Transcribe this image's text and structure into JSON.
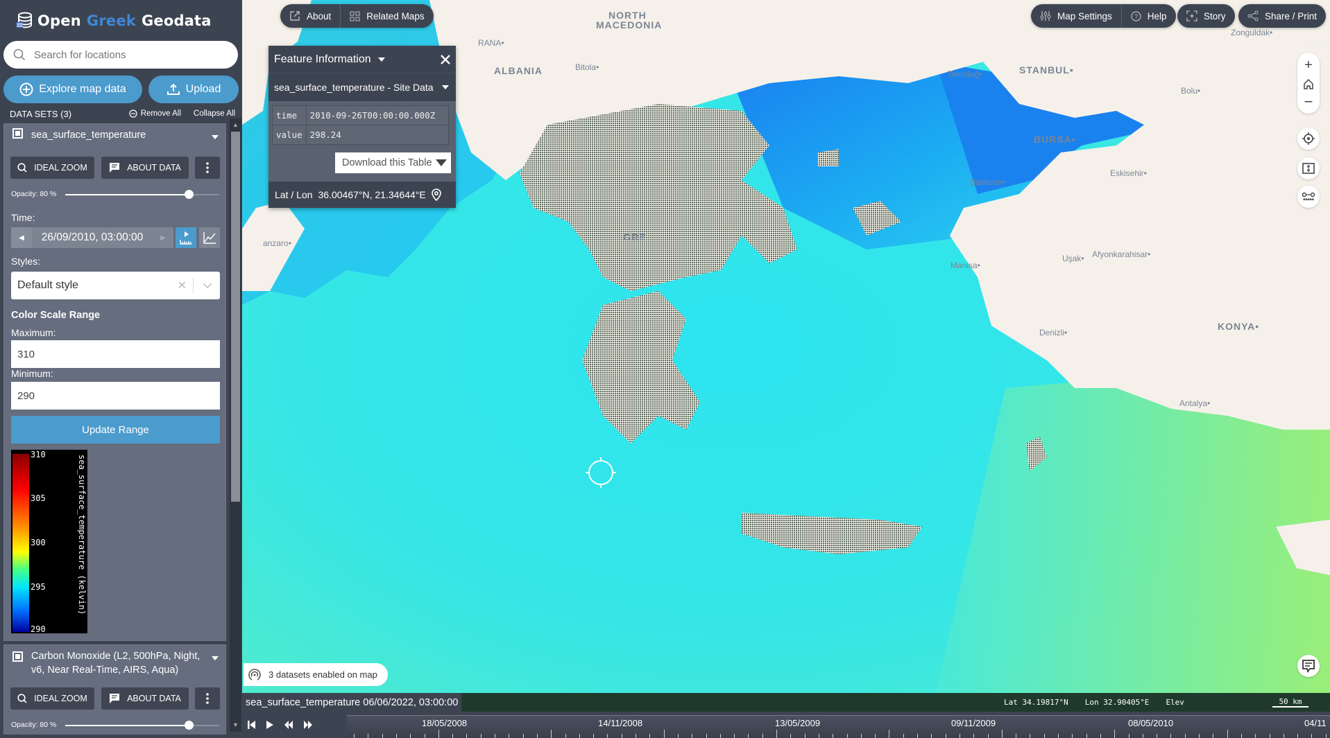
{
  "app": {
    "title_parts": [
      "Open",
      "Greek",
      "Geodata"
    ],
    "accent": "#3f88d8"
  },
  "search": {
    "placeholder": "Search for locations",
    "value": ""
  },
  "actions": {
    "explore": "Explore map data",
    "upload": "Upload"
  },
  "datasets": {
    "header": "DATA SETS (3)",
    "remove_all": "Remove All",
    "collapse_all": "Collapse All",
    "items": [
      {
        "title": "sea_surface_temperature",
        "ideal_zoom": "IDEAL ZOOM",
        "about_data": "ABOUT DATA",
        "opacity_label": "Opacity: 80 %",
        "opacity": 0.8,
        "time_label": "Time:",
        "time_value": "26/09/2010, 03:00:00",
        "styles_label": "Styles:",
        "style_value": "Default style",
        "color_scale_title": "Color Scale Range",
        "max_label": "Maximum:",
        "max_value": "310",
        "min_label": "Minimum:",
        "min_value": "290",
        "update_label": "Update Range",
        "legend": {
          "ticks": [
            "310",
            "305",
            "300",
            "295",
            "290"
          ],
          "title": "sea_surface_temperature (kelvin)"
        }
      },
      {
        "title": "Carbon Monoxide (L2, 500hPa, Night, v6, Near Real-Time, AIRS, Aqua)",
        "ideal_zoom": "IDEAL ZOOM",
        "about_data": "ABOUT DATA",
        "opacity_label": "Opacity: 80 %",
        "opacity": 0.8
      }
    ]
  },
  "topbar": {
    "about": "About",
    "related_maps": "Related Maps",
    "map_settings": "Map Settings",
    "help": "Help",
    "story": "Story",
    "share_print": "Share / Print"
  },
  "feature_info": {
    "title": "Feature Information",
    "subtitle": "sea_surface_temperature - Site Data",
    "rows": [
      {
        "key": "time",
        "value": "2010-09-26T00:00:00.000Z"
      },
      {
        "key": "value",
        "value": "298.24"
      }
    ],
    "download": "Download this Table",
    "latlon_label": "Lat / Lon",
    "latlon_value": "36.00467°N, 21.34644°E"
  },
  "map_labels": [
    {
      "text": "NORTH",
      "cls": "big"
    },
    {
      "text": "MACEDONIA",
      "cls": "big"
    },
    {
      "text": "ALBANIA",
      "cls": "big"
    },
    {
      "text": "RANA•",
      "cls": ""
    },
    {
      "text": "Bitola•",
      "cls": ""
    },
    {
      "text": "Tekirdağ•",
      "cls": ""
    },
    {
      "text": "STANBUL•",
      "cls": "big"
    },
    {
      "text": "BURSA•",
      "cls": "big"
    },
    {
      "text": "Balıkesir•",
      "cls": ""
    },
    {
      "text": "Eskisehir•",
      "cls": ""
    },
    {
      "text": "Bolu•",
      "cls": ""
    },
    {
      "text": "Manisa•",
      "cls": ""
    },
    {
      "text": "Uşak•",
      "cls": ""
    },
    {
      "text": "Afyonkarahisar•",
      "cls": ""
    },
    {
      "text": "Denizli•",
      "cls": ""
    },
    {
      "text": "KONYA•",
      "cls": "big"
    },
    {
      "text": "Antalya•",
      "cls": ""
    },
    {
      "text": "Zonguldak•",
      "cls": ""
    },
    {
      "text": "anzaro•",
      "cls": ""
    },
    {
      "text": "GRE",
      "cls": "big"
    }
  ],
  "status": {
    "datasets_enabled": "3 datasets enabled on map",
    "layer_time": "sea_surface_temperature 06/06/2022, 03:00:00",
    "lat": "Lat  34.19817°N",
    "lon": "Lon  32.90405°E",
    "elev": "Elev",
    "scale": "50 km"
  },
  "timeline": {
    "labels": [
      "18/05/2008",
      "14/11/2008",
      "13/05/2009",
      "09/11/2009",
      "08/05/2010",
      "04/11"
    ]
  }
}
